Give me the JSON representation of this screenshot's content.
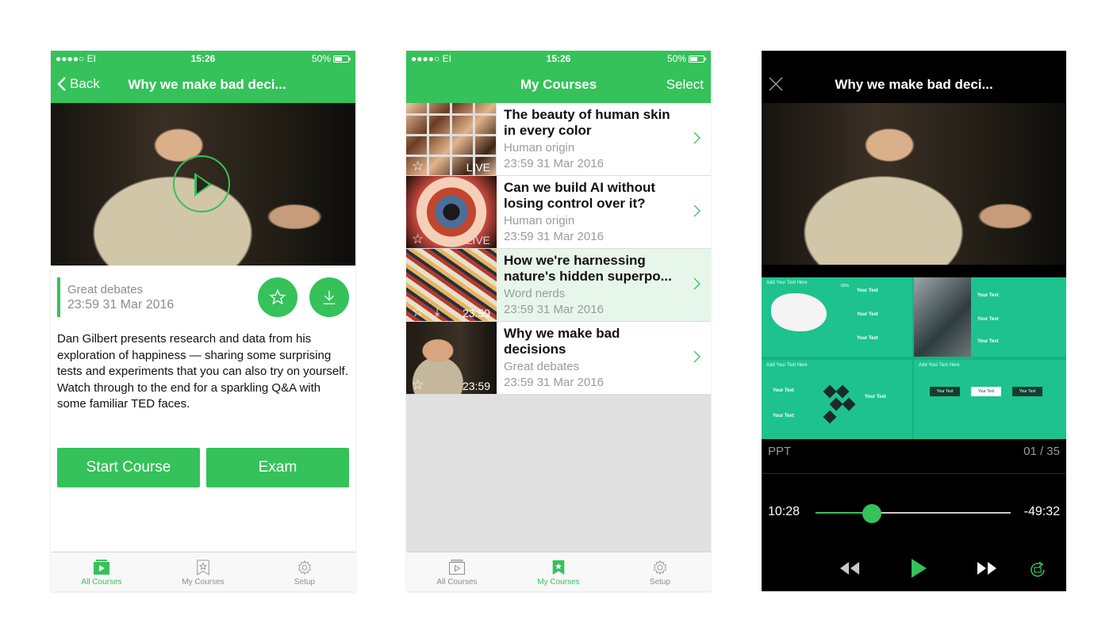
{
  "colors": {
    "accent": "#35c25a",
    "highlight_row": "#e7f6ea"
  },
  "status_bar": {
    "carrier": "●●●●○ EI",
    "time": "15:26",
    "battery": "50%"
  },
  "detail_screen": {
    "back_label": "Back",
    "title": "Why we make bad deci...",
    "category": "Great debates",
    "date": "23:59 31 Mar 2016",
    "description": "Dan Gilbert presents research and data from his exploration of happiness — sharing some surprising tests and experiments that you can also try on yourself. Watch through to the end for a sparkling Q&A with some familiar TED faces.",
    "start_course_label": "Start Course",
    "exam_label": "Exam",
    "icons": [
      "play-icon",
      "star-icon",
      "download-icon"
    ]
  },
  "list_screen": {
    "title": "My Courses",
    "select_label": "Select",
    "items": [
      {
        "title": "The beauty of human skin in every color",
        "category": "Human origin",
        "date": "23:59 31 Mar 2016",
        "badge": "LIVE",
        "thumb": "faces"
      },
      {
        "title": "Can we build AI without losing control over it?",
        "category": "Human origin",
        "date": "23:59 31 Mar 2016",
        "badge": "LIVE",
        "thumb": "eye"
      },
      {
        "title": "How we're harnessing nature's hidden superpo...",
        "category": "Word nerds",
        "date": "23:59 31 Mar 2016",
        "badge": "23:59",
        "thumb": "bird",
        "highlighted": true
      },
      {
        "title": "Why we make bad decisions",
        "category": "Great debates",
        "date": "23:59 31 Mar 2016",
        "badge": "23:59",
        "thumb": "gilbert"
      }
    ]
  },
  "player_screen": {
    "title": "Why we make bad deci...",
    "ppt_label": "PPT",
    "slide_counter": "01 / 35",
    "elapsed": "10:28",
    "remaining": "-49:32",
    "progress": 0.29,
    "slide_texts": {
      "add_text": "Add Your Text Here",
      "your_text": "Your Text",
      "pct": "50%"
    }
  },
  "tabbar": {
    "all_courses": "All Courses",
    "my_courses": "My Courses",
    "setup": "Setup"
  }
}
